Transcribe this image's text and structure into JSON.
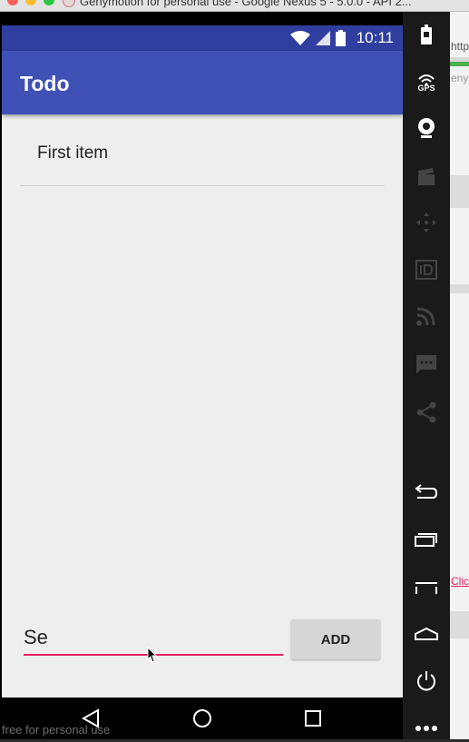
{
  "window": {
    "title": "Genymotion for personal use - Google Nexus 5 - 5.0.0 - API 2..."
  },
  "status_bar": {
    "time": "10:11"
  },
  "app_bar": {
    "title": "Todo"
  },
  "todo_list": {
    "items": [
      {
        "label": "First item"
      }
    ]
  },
  "input_row": {
    "input_value": "Se",
    "add_label": "ADD"
  },
  "footer": {
    "watermark": "free for personal use"
  },
  "side_panel": {
    "gps_label": "GPS"
  },
  "background_window": {
    "text_top": "http",
    "text_mid": "enyr",
    "link_text": "Click"
  },
  "colors": {
    "status_bar": "#303f9f",
    "app_bar": "#3f51b5",
    "accent": "#e91e63",
    "screen_background": "#eeeeee"
  },
  "icons": [
    "wifi-icon",
    "signal-icon",
    "battery-icon",
    "back-icon",
    "home-icon",
    "recents-icon",
    "gps-icon",
    "camera-icon",
    "video-icon",
    "move-icon",
    "id-icon",
    "rss-icon",
    "sms-icon",
    "share-icon",
    "undo-icon",
    "recent-apps-icon",
    "menu-icon",
    "home-outline-icon",
    "power-icon",
    "more-icon"
  ]
}
